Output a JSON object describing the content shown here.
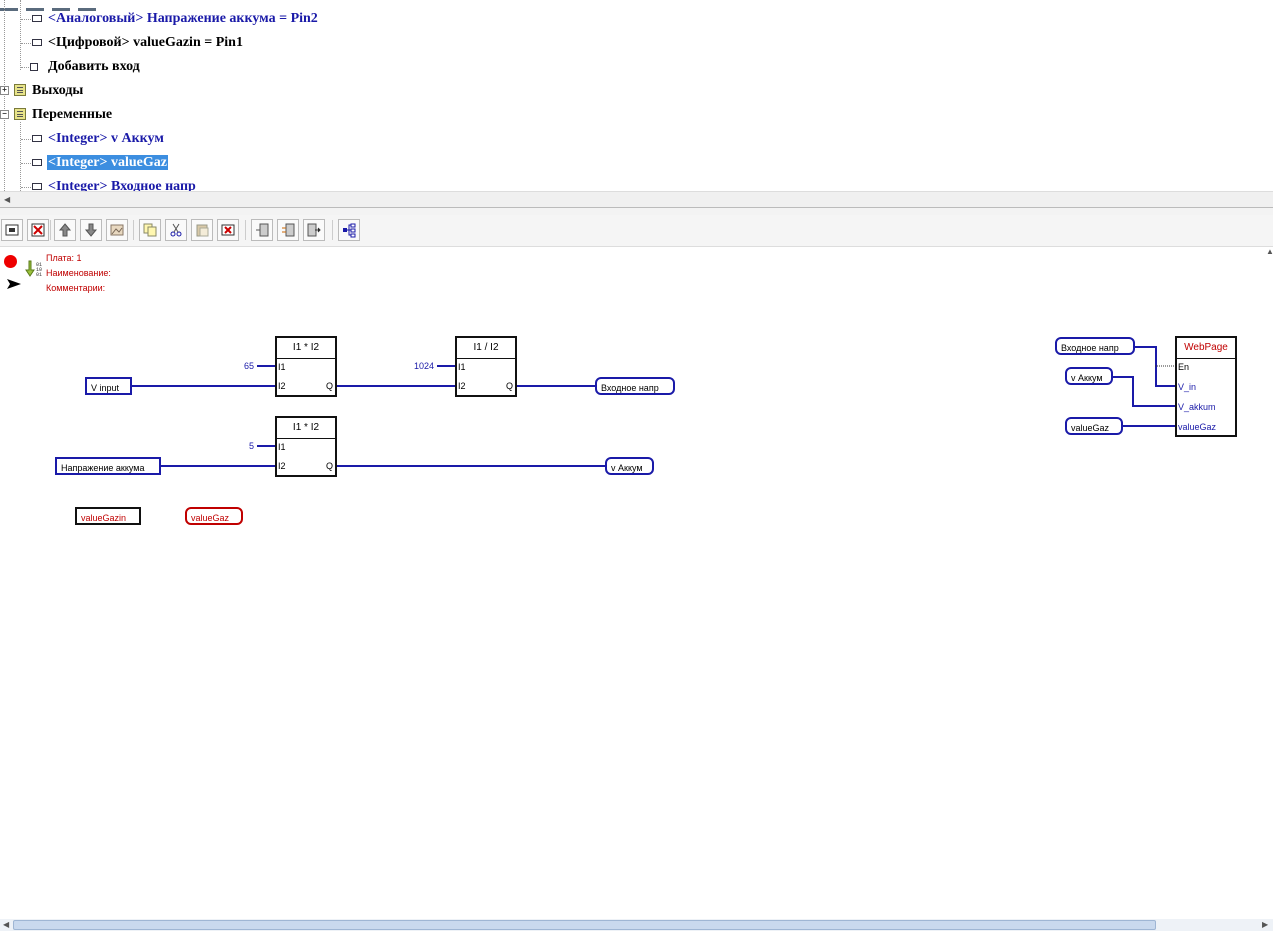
{
  "tree": {
    "items": [
      {
        "label": "<Аналоговый> Напражение аккума = Pin2",
        "style": "blue"
      },
      {
        "label": "<Цифровой> valueGazin = Pin1",
        "style": "black"
      },
      {
        "label": "Добавить вход",
        "style": "black"
      },
      {
        "label": "Выходы",
        "style": "black"
      },
      {
        "label": "Переменные",
        "style": "black"
      },
      {
        "label": "<Integer> v Аккум",
        "style": "blue"
      },
      {
        "label": "<Integer> valueGaz",
        "style": "selected"
      },
      {
        "label": "<Integer> Входное напр",
        "style": "blue"
      }
    ]
  },
  "toolbar": {
    "buttons": [
      "add-block-icon",
      "delete-icon",
      "move-up-icon",
      "move-down-icon",
      "image-icon",
      "copy-icon",
      "cut-icon",
      "paste-icon",
      "delete-block-icon",
      "align-left-icon",
      "align-right-icon",
      "export-icon",
      "tree-view-icon"
    ]
  },
  "board": {
    "plate": "Плата: 1",
    "name": "Наименование:",
    "comments": "Комментарии:"
  },
  "diagram": {
    "blocks": {
      "mul1": {
        "title": "I1 * I2",
        "in1": "I1",
        "in2": "I2",
        "out": "Q",
        "const": "65"
      },
      "div1": {
        "title": "I1 / I2",
        "in1": "I1",
        "in2": "I2",
        "out": "Q",
        "const": "1024"
      },
      "mul2": {
        "title": "I1 * I2",
        "in1": "I1",
        "in2": "I2",
        "out": "Q",
        "const": "5"
      },
      "webpage": {
        "title": "WebPage",
        "pins": [
          "En",
          "V_in",
          "V_akkum",
          "valueGaz"
        ]
      }
    },
    "vars": {
      "v_input": "V input",
      "vhodnoe_out": "Входное напр",
      "napr_akkuma": "Напражение аккума",
      "v_akkum_out": "v Аккум",
      "valuegazin": "valueGazin",
      "valuegaz_red": "valueGaz",
      "web_vhodnoe": "Входное напр",
      "web_v_akkum": "v Аккум",
      "web_valuegaz": "valueGaz"
    }
  },
  "colors": {
    "wire": "#1a1aa8",
    "selection": "#3c8ee0",
    "info_text": "#c00000"
  }
}
